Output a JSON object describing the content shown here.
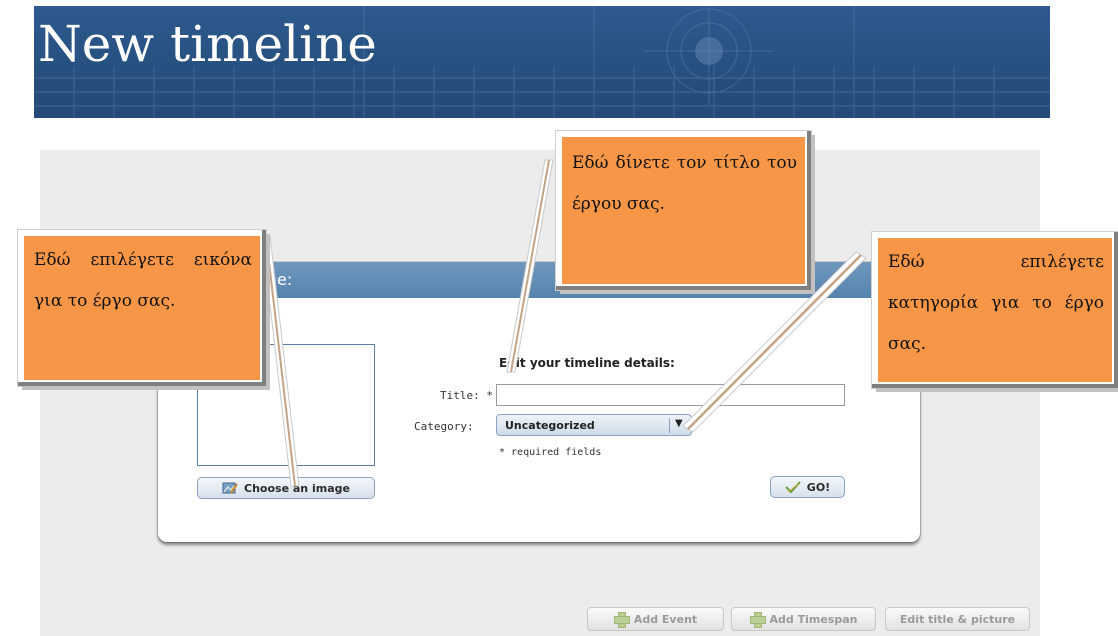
{
  "slide": {
    "title": "New timeline"
  },
  "dialog": {
    "title_partial": "line:",
    "details_heading": "Edit your timeline details:",
    "title_label": "Title: *",
    "title_value": "",
    "category_label": "Category:",
    "category_selected": "Uncategorized",
    "required_note": "* required fields",
    "choose_image_label": "Choose an image",
    "go_label": "GO!"
  },
  "toolbar": {
    "add_event": "Add Event",
    "add_timespan": "Add Timespan",
    "edit_title_picture": "Edit title & picture"
  },
  "callouts": {
    "image": "Εδώ επιλέγετε εικόνα για το έργο σας.",
    "title": "Εδώ δίνετε τον τίτλο του έργου σας.",
    "category": "Εδώ επιλέγετε κατηγορία για το έργο σας."
  },
  "colors": {
    "banner": "#2b5588",
    "callout": "#f79646",
    "dialog_header": "#5f8cb4"
  }
}
